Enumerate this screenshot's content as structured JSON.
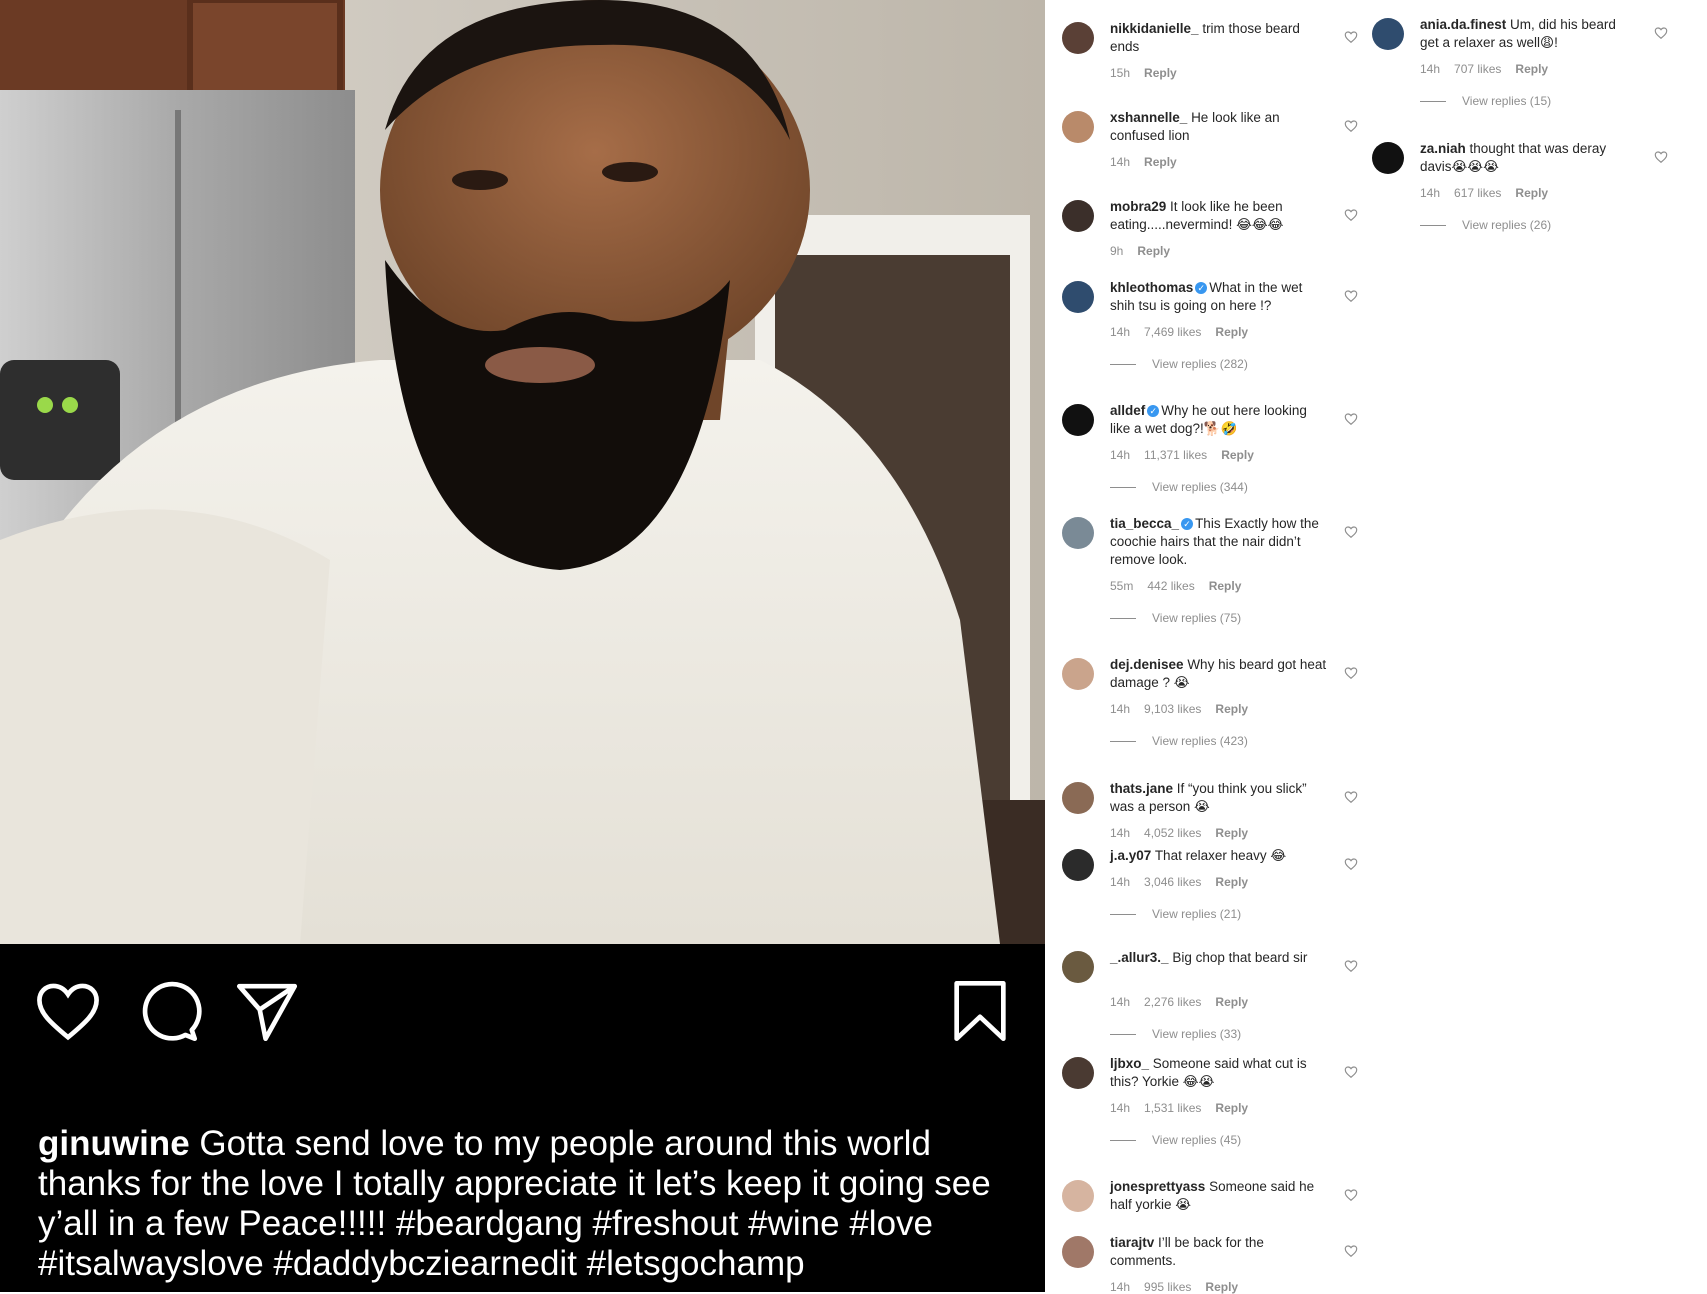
{
  "post": {
    "caption_user": "ginuwine",
    "caption_text": " Gotta send love to my people around this world thanks for the love I totally appreciate it let’s keep it going see y’all in a few Peace!!!!! #beardgang #freshout #wine #love #itsalwayslove #daddybcziearnedit #letsgochamp"
  },
  "icons": {
    "like": "heart-outline-icon",
    "comment": "speech-bubble-icon",
    "share": "paper-plane-icon",
    "save": "bookmark-icon"
  },
  "colors": {
    "panel_bg": "#000000",
    "text": "#262626",
    "muted": "#8e8e8e",
    "verified": "#3897f0"
  },
  "comments_left": [
    {
      "user": "nikkidanielle_",
      "verified": false,
      "text": "trim those beard ends",
      "time": "15h",
      "likes": "",
      "reply": "Reply",
      "view_replies": ""
    },
    {
      "user": "xshannelle_",
      "verified": false,
      "text": "He look like an confused lion",
      "time": "14h",
      "likes": "",
      "reply": "Reply",
      "view_replies": ""
    },
    {
      "user": "mobra29",
      "verified": false,
      "text": "It look like he been eating.....nevermind! 😂😂😂",
      "time": "9h",
      "likes": "",
      "reply": "Reply",
      "view_replies": ""
    },
    {
      "user": "khleothomas",
      "verified": true,
      "text": "What in the wet shih tsu is going on here !?",
      "time": "14h",
      "likes": "7,469 likes",
      "reply": "Reply",
      "view_replies": "View replies (282)"
    },
    {
      "user": "alldef",
      "verified": true,
      "text": "Why he out here looking like a wet dog?!🐕🤣",
      "time": "14h",
      "likes": "11,371 likes",
      "reply": "Reply",
      "view_replies": "View replies (344)"
    },
    {
      "user": "tia_becca_",
      "verified": true,
      "text": "This Exactly how the coochie hairs that the nair didn’t remove look.",
      "time": "55m",
      "likes": "442 likes",
      "reply": "Reply",
      "view_replies": "View replies (75)"
    },
    {
      "user": "dej.denisee",
      "verified": false,
      "text": "Why his beard got heat damage ? 😭",
      "time": "14h",
      "likes": "9,103 likes",
      "reply": "Reply",
      "view_replies": "View replies (423)"
    },
    {
      "user": "thats.jane",
      "verified": false,
      "text": "If “you think you slick” was a person 😭",
      "time": "14h",
      "likes": "4,052 likes",
      "reply": "Reply",
      "view_replies": ""
    },
    {
      "user": "j.a.y07",
      "verified": false,
      "text": "That relaxer heavy 😂",
      "time": "14h",
      "likes": "3,046 likes",
      "reply": "Reply",
      "view_replies": "View replies (21)"
    },
    {
      "user": "_.allur3._",
      "verified": false,
      "text": "Big chop that beard sir",
      "time": "14h",
      "likes": "2,276 likes",
      "reply": "Reply",
      "view_replies": "View replies (33)"
    },
    {
      "user": "ljbxo_",
      "verified": false,
      "text": "Someone said what cut is this? Yorkie 😂😭",
      "time": "14h",
      "likes": "1,531 likes",
      "reply": "Reply",
      "view_replies": "View replies (45)"
    },
    {
      "user": "jonesprettyass",
      "verified": false,
      "text": "Someone said he half yorkie 😭",
      "time": "",
      "likes": "",
      "reply": "",
      "view_replies": ""
    },
    {
      "user": "tiarajtv",
      "verified": false,
      "text": "I’ll be back for the comments.",
      "time": "14h",
      "likes": "995 likes",
      "reply": "Reply",
      "view_replies": ""
    }
  ],
  "comments_right": [
    {
      "user": "ania.da.finest",
      "verified": false,
      "text": "Um, did his beard get a relaxer as well😩!",
      "time": "14h",
      "likes": "707 likes",
      "reply": "Reply",
      "view_replies": "View replies (15)"
    },
    {
      "user": "za.niah",
      "verified": false,
      "text": "thought that was deray davis😭😭😭",
      "time": "14h",
      "likes": "617 likes",
      "reply": "Reply",
      "view_replies": "View replies (26)"
    }
  ]
}
